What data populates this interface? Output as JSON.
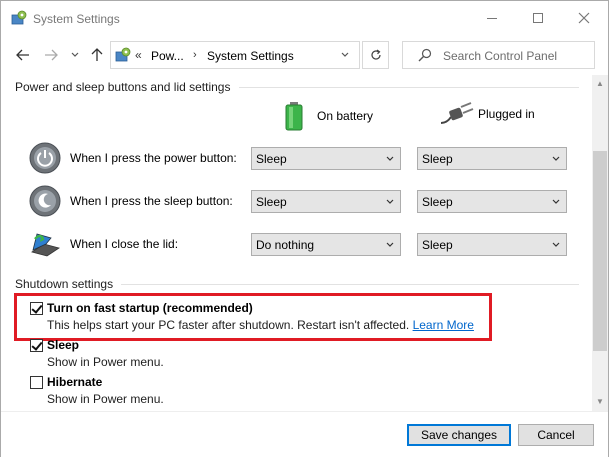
{
  "window": {
    "title": "System Settings",
    "controls": [
      "minimize",
      "maximize",
      "close"
    ]
  },
  "nav": {
    "breadcrumb_prefix": "«",
    "breadcrumb_items": [
      "Pow...",
      "System Settings"
    ],
    "search_placeholder": "Search Control Panel"
  },
  "power_section": {
    "heading": "Power and sleep buttons and lid settings",
    "columns": {
      "battery": "On battery",
      "plugged": "Plugged in"
    },
    "rows": [
      {
        "label": "When I press the power button:",
        "battery": "Sleep",
        "plugged": "Sleep",
        "icon": "power-button-icon"
      },
      {
        "label": "When I press the sleep button:",
        "battery": "Sleep",
        "plugged": "Sleep",
        "icon": "sleep-button-icon"
      },
      {
        "label": "When I close the lid:",
        "battery": "Do nothing",
        "plugged": "Sleep",
        "icon": "laptop-lid-icon"
      }
    ]
  },
  "shutdown_section": {
    "heading": "Shutdown settings",
    "options": [
      {
        "label": "Turn on fast startup (recommended)",
        "desc": "This helps start your PC faster after shutdown. Restart isn't affected.",
        "link": "Learn More",
        "checked": true
      },
      {
        "label": "Sleep",
        "desc": "Show in Power menu.",
        "checked": true
      },
      {
        "label": "Hibernate",
        "desc": "Show in Power menu.",
        "checked": false
      }
    ]
  },
  "footer": {
    "save_label": "Save changes",
    "cancel_label": "Cancel"
  },
  "colors": {
    "highlight": "#e01b24",
    "link": "#0066cc",
    "battery_green": "#3cb44a",
    "focus_blue": "#0078d7"
  }
}
